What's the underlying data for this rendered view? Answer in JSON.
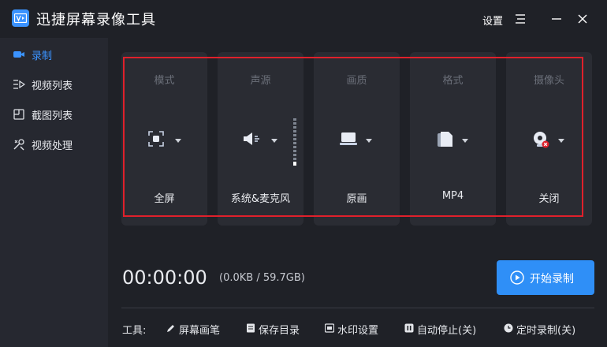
{
  "app": {
    "title": "迅捷屏幕录像工具"
  },
  "header": {
    "settings_label": "设置"
  },
  "sidebar": {
    "items": [
      {
        "label": "录制",
        "icon": "camera-icon",
        "active": true
      },
      {
        "label": "视频列表",
        "icon": "list-icon"
      },
      {
        "label": "截图列表",
        "icon": "image-icon"
      },
      {
        "label": "视频处理",
        "icon": "tools-icon"
      }
    ]
  },
  "options": [
    {
      "caption": "模式",
      "value": "全屏",
      "icon": "fullscreen-icon"
    },
    {
      "caption": "声源",
      "value": "系统&麦克风",
      "icon": "speaker-icon"
    },
    {
      "caption": "画质",
      "value": "原画",
      "icon": "monitor-icon"
    },
    {
      "caption": "格式",
      "value": "MP4",
      "icon": "file-icon"
    },
    {
      "caption": "摄像头",
      "value": "关闭",
      "icon": "webcam-off-icon"
    }
  ],
  "status": {
    "timer": "00:00:00",
    "size": "(0.0KB / 59.7GB)"
  },
  "record_button": {
    "label": "开始录制"
  },
  "tools": {
    "title": "工具:",
    "items": [
      {
        "label": "屏幕画笔",
        "icon": "pen-icon"
      },
      {
        "label": "保存目录",
        "icon": "folder-icon"
      },
      {
        "label": "水印设置",
        "icon": "watermark-icon"
      },
      {
        "label": "自动停止(关)",
        "icon": "pause-icon"
      },
      {
        "label": "定时录制(关)",
        "icon": "clock-icon"
      }
    ]
  },
  "colors": {
    "accent": "#2f8ff7",
    "highlight": "#e0202b",
    "background": "#1f2127"
  }
}
